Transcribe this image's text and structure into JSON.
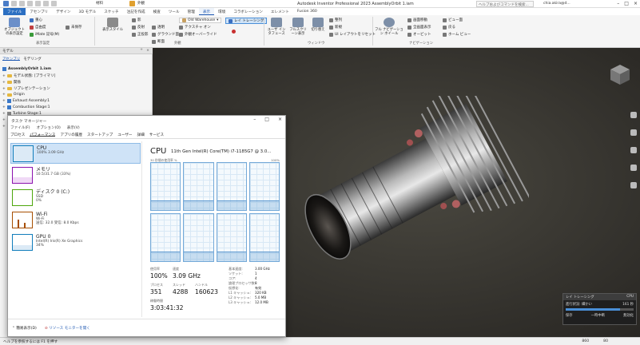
{
  "titlebar": {
    "app_title": "Autodesk Inventor Professional 2023    AssemblyOrbit 1.iam",
    "search_placeholder": "ヘルプおよびコマンドを検索...",
    "user": "chia.akira@d...",
    "qat": {
      "material": "材料",
      "appearance": "外観"
    }
  },
  "ribbon_tabs": [
    "ファイル",
    "アセンブリ",
    "デザイン",
    "3D モデル",
    "スケッチ",
    "注記を作成",
    "検査",
    "ツール",
    "管理",
    "表示",
    "環境",
    "コラボレーション",
    "エレメント",
    "Fusion 360"
  ],
  "active_tab": "表示",
  "ribbon": {
    "visibility": {
      "object_visibility": "オブジェクトの表示設定",
      "center_of_gravity": "重心",
      "dof": "自由度",
      "imate": "iMate 記号(M)",
      "unsaved": "未保存",
      "group_label": "表示設定"
    },
    "appearance": {
      "display_style": "表示スタイル",
      "shadows": "影",
      "reflection": "反射",
      "ground_plane": "グラウンド面",
      "orthographic": "正投影",
      "transparency": "透明",
      "cross_section": "断面",
      "warehouse": "Old Warehouse",
      "texture_on": "テクスチャ オン",
      "light_appearance": "外観オーバーライド",
      "ray_tracing": "レイ トレーシング",
      "group_label": "外観"
    },
    "windows": {
      "user_interface": "ユーザ インタフェース",
      "full_screen": "フルスクリーン表示",
      "switch": "切り替え",
      "arrange": "整列",
      "new": "新規",
      "ui_layout": "UI レイアウトをリセット",
      "group_label": "ウィンドウ"
    },
    "navigation": {
      "full_nav_wheel": "フル ナビゲーション ホイール",
      "free_orbit": "画面移動",
      "zoom_all": "全画面表示",
      "orbit": "オービット",
      "view_face": "ビュー面",
      "look_at": "ホーム ビュー",
      "back": "戻る",
      "group_label": "ナビゲーション"
    }
  },
  "browser": {
    "title": "モデル",
    "tabs": [
      "アセンブリ",
      "モデリング"
    ],
    "tree": [
      {
        "label": "AssemblyOrbit 1.iam",
        "type": "asm"
      },
      {
        "label": "モデル状態: [プライマリ]",
        "type": "folder"
      },
      {
        "label": "関係",
        "type": "folder"
      },
      {
        "label": "リプレゼンテーション",
        "type": "folder"
      },
      {
        "label": "Origin",
        "type": "folder"
      },
      {
        "label": "Exhaust Assembly:1",
        "type": "asm"
      },
      {
        "label": "Combustion Stage:1",
        "type": "asm"
      },
      {
        "label": "Turbine Stage:1",
        "type": "part"
      },
      {
        "label": "Compressor:1",
        "type": "part"
      },
      {
        "label": "Inlet Fan:1",
        "type": "part"
      }
    ]
  },
  "task_manager": {
    "title": "タスク マネージャー",
    "menu": [
      "ファイル(F)",
      "オプション(O)",
      "表示(V)"
    ],
    "tabs": [
      "プロセス",
      "パフォーマンス",
      "アプリの履歴",
      "スタートアップ",
      "ユーザー",
      "詳細",
      "サービス"
    ],
    "active_tab": "パフォーマンス",
    "resources": [
      {
        "name": "CPU",
        "sub1": "100% 3.09 GHz",
        "sub2": "",
        "color": "#117dbb"
      },
      {
        "name": "メモリ",
        "sub1": "10.5/31.7 GB (33%)",
        "sub2": "",
        "color": "#8b12ae"
      },
      {
        "name": "ディスク 0 (C:)",
        "sub1": "SSD",
        "sub2": "0%",
        "color": "#4da60c"
      },
      {
        "name": "Wi-Fi",
        "sub1": "Wi-Fi",
        "sub2": "送信: 32.0 受信: 8.0 Kbps",
        "color": "#a74f01"
      },
      {
        "name": "GPU 0",
        "sub1": "Intel(R) Iris(R) Xe Graphics",
        "sub2": "34%",
        "color": "#117dbb"
      }
    ],
    "cpu": {
      "title": "CPU",
      "model": "11th Gen Intel(R) Core(TM) i7-1185G7 @ 3.0...",
      "util_label": "30 秒間の使用率 %",
      "max_label": "100%",
      "util_labels": [
        "使用率",
        "速度",
        "プロセス",
        "スレッド",
        "ハンドル",
        "稼働時間"
      ],
      "util_value": "100%",
      "speed_value": "3.09 GHz",
      "processes": "351",
      "threads": "4288",
      "handles": "160623",
      "uptime": "3:03:41:32",
      "specs": [
        {
          "k": "基本速度:",
          "v": "3.00 GHz"
        },
        {
          "k": "ソケット:",
          "v": "1"
        },
        {
          "k": "コア:",
          "v": "4"
        },
        {
          "k": "論理プロセッサ数:",
          "v": "8"
        },
        {
          "k": "仮想化:",
          "v": "有効"
        },
        {
          "k": "L1 キャッシュ:",
          "v": "320 KB"
        },
        {
          "k": "L2 キャッシュ:",
          "v": "5.0 MB"
        },
        {
          "k": "L3 キャッシュ:",
          "v": "12.0 MB"
        }
      ]
    },
    "footer": {
      "fewer": "簡易表示(D)",
      "resmon": "リソース モニターを開く"
    }
  },
  "ray_panel": {
    "title": "レイ トレーシング",
    "mode": "CPU",
    "status": "進行状況: 細かい",
    "time": "161 秒",
    "progress": 0.8,
    "actions": [
      "保存",
      "一時中断",
      "無効化"
    ]
  },
  "statusbar": {
    "left": "ヘルプを参照するには F1 を押す",
    "v1": "860",
    "v2": "80"
  }
}
